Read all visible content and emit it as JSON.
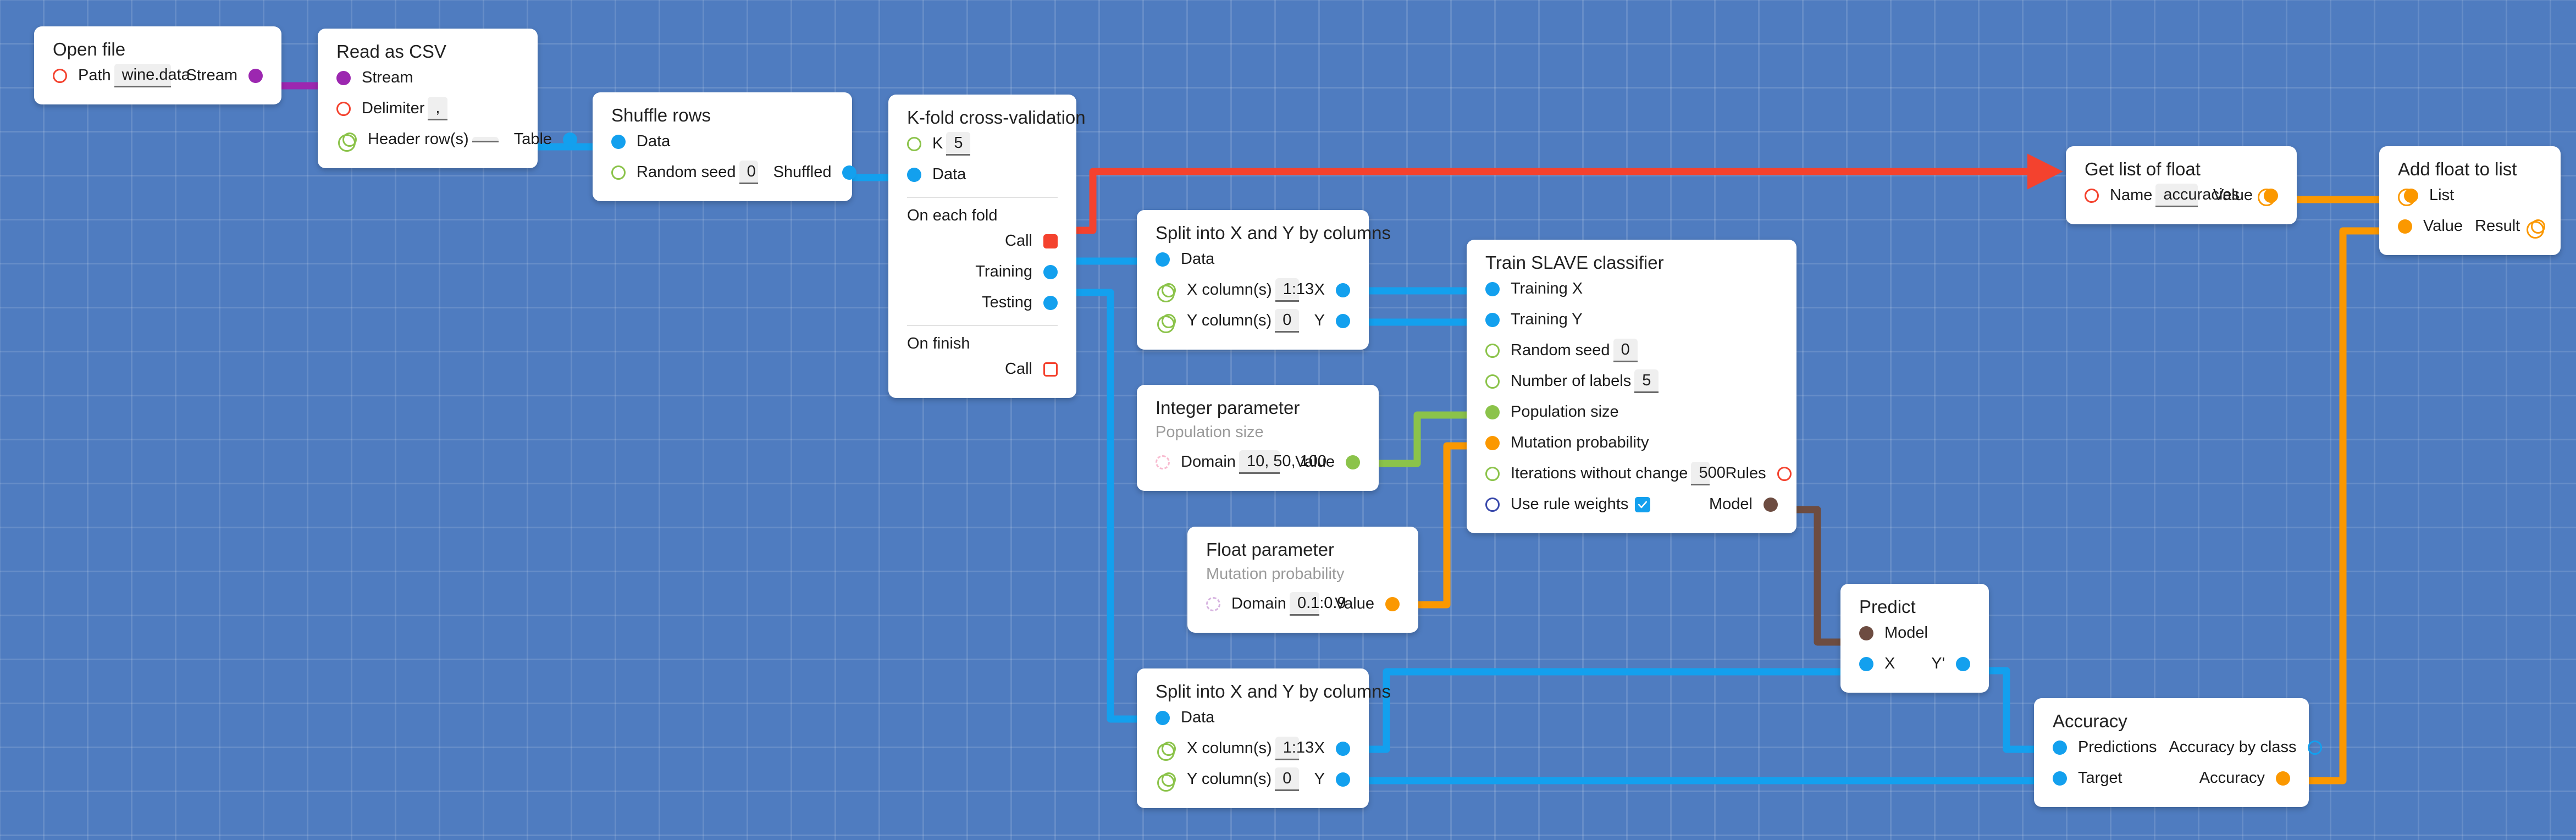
{
  "canvas": {
    "background_color": "#4f7cc0",
    "grid_size": 80,
    "grid_color": "#6f93cc"
  },
  "palette": {
    "blue": "#13a0ee",
    "red": "#f4422e",
    "green": "#8bc34a",
    "purple": "#9c27b0",
    "orange": "#fb9800",
    "brown": "#6d4c41",
    "navy": "#3949ab",
    "node_bg": "#ffffff",
    "field_bg": "#efefef"
  },
  "nodes": {
    "open_file": {
      "title": "Open file",
      "path_label": "Path",
      "path_value": "wine.data",
      "stream_label": "Stream"
    },
    "read_csv": {
      "title": "Read as CSV",
      "stream_label": "Stream",
      "delimiter_label": "Delimiter",
      "delimiter_value": ",",
      "header_label": "Header row(s)",
      "header_value": "",
      "table_label": "Table"
    },
    "shuffle_rows": {
      "title": "Shuffle rows",
      "data_label": "Data",
      "seed_label": "Random seed",
      "seed_value": "0",
      "shuffled_label": "Shuffled"
    },
    "kfold": {
      "title": "K-fold cross-validation",
      "k_label": "K",
      "k_value": "5",
      "data_label": "Data",
      "on_each_fold_label": "On each fold",
      "call_label": "Call",
      "training_label": "Training",
      "testing_label": "Testing",
      "on_finish_label": "On finish",
      "finish_call_label": "Call"
    },
    "split_top": {
      "title": "Split into X and Y by columns",
      "data_label": "Data",
      "x_columns_label": "X column(s)",
      "x_columns_value": "1:13",
      "y_columns_label": "Y column(s)",
      "y_columns_value": "0",
      "x_out_label": "X",
      "y_out_label": "Y"
    },
    "split_bottom": {
      "title": "Split into X and Y by columns",
      "data_label": "Data",
      "x_columns_label": "X column(s)",
      "x_columns_value": "1:13",
      "y_columns_label": "Y column(s)",
      "y_columns_value": "0",
      "x_out_label": "X",
      "y_out_label": "Y"
    },
    "train_slave": {
      "title": "Train SLAVE classifier",
      "training_x_label": "Training X",
      "training_y_label": "Training Y",
      "seed_label": "Random seed",
      "seed_value": "0",
      "labels_label": "Number of labels",
      "labels_value": "5",
      "population_label": "Population size",
      "mutation_label": "Mutation probability",
      "iterations_label": "Iterations without change",
      "iterations_value": "500",
      "rules_label": "Rules",
      "rule_weights_label": "Use rule weights",
      "rule_weights_checked": true,
      "model_label": "Model"
    },
    "integer_parameter": {
      "title": "Integer parameter",
      "subtitle": "Population size",
      "domain_label": "Domain",
      "domain_value": "10, 50, 100",
      "value_label": "Value"
    },
    "float_parameter": {
      "title": "Float parameter",
      "subtitle": "Mutation probability",
      "domain_label": "Domain",
      "domain_value": "0.1:0.9",
      "value_label": "Value"
    },
    "get_list_of_float": {
      "title": "Get list of float",
      "name_label": "Name",
      "name_value": "accuracies",
      "value_label": "Value"
    },
    "add_float_to_list": {
      "title": "Add float to list",
      "list_label": "List",
      "value_label": "Value",
      "result_label": "Result"
    },
    "predict": {
      "title": "Predict",
      "model_label": "Model",
      "x_label": "X",
      "y_out_label": "Y'"
    },
    "accuracy": {
      "title": "Accuracy",
      "predictions_label": "Predictions",
      "target_label": "Target",
      "accuracy_by_class_label": "Accuracy by class",
      "accuracy_label": "Accuracy"
    }
  },
  "edges": [
    {
      "id": "e1",
      "from": "open_file.stream",
      "to": "read_csv.stream",
      "color": "#9c27b0"
    },
    {
      "id": "e2",
      "from": "read_csv.table",
      "to": "shuffle_rows.data",
      "color": "#13a0ee"
    },
    {
      "id": "e3",
      "from": "shuffle_rows.shuffled",
      "to": "kfold.data",
      "color": "#13a0ee"
    },
    {
      "id": "e4",
      "from": "kfold.call",
      "to": "get_list_of_float",
      "color": "#f4422e",
      "arrow": true
    },
    {
      "id": "e5",
      "from": "kfold.training",
      "to": "split_top.data",
      "color": "#13a0ee"
    },
    {
      "id": "e6",
      "from": "kfold.testing",
      "to": "split_bottom.data",
      "color": "#13a0ee"
    },
    {
      "id": "e7",
      "from": "split_top.x",
      "to": "train_slave.training_x",
      "color": "#13a0ee"
    },
    {
      "id": "e8",
      "from": "split_top.y",
      "to": "train_slave.training_y",
      "color": "#13a0ee"
    },
    {
      "id": "e9",
      "from": "integer_parameter.value",
      "to": "train_slave.population_size",
      "color": "#8bc34a"
    },
    {
      "id": "e10",
      "from": "float_parameter.value",
      "to": "train_slave.mutation_probability",
      "color": "#fb9800"
    },
    {
      "id": "e11",
      "from": "train_slave.model",
      "to": "predict.model",
      "color": "#6d4c41"
    },
    {
      "id": "e12",
      "from": "split_bottom.x",
      "to": "predict.x",
      "color": "#13a0ee"
    },
    {
      "id": "e13",
      "from": "split_bottom.y",
      "to": "accuracy.target",
      "color": "#13a0ee"
    },
    {
      "id": "e14",
      "from": "predict.y_out",
      "to": "accuracy.predictions",
      "color": "#13a0ee"
    },
    {
      "id": "e15",
      "from": "get_list_of_float.value",
      "to": "add_float_to_list.list",
      "color": "#fb9800"
    },
    {
      "id": "e16",
      "from": "accuracy.accuracy",
      "to": "add_float_to_list.value",
      "color": "#fb9800"
    }
  ]
}
